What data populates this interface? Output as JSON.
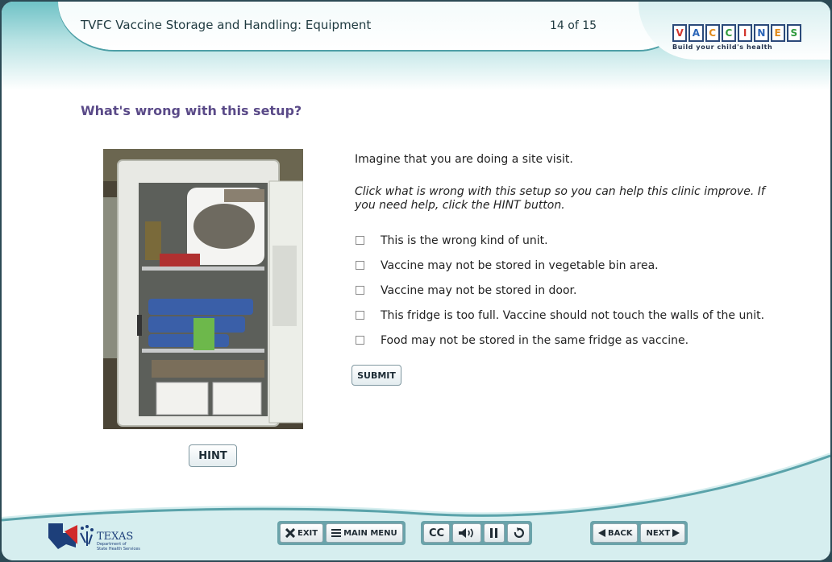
{
  "header": {
    "course_title": "TVFC Vaccine Storage and Handling: Equipment",
    "page_counter": "14 of 15",
    "logo_letters": [
      "V",
      "A",
      "C",
      "C",
      "I",
      "N",
      "E",
      "S"
    ],
    "logo_tagline": "Build your child's health"
  },
  "question": {
    "title": "What's wrong with this setup?",
    "intro": "Imagine that you are doing a site visit.",
    "instruction": "Click what is wrong with this setup so you can help this clinic improve. If you need help, click the HINT button.",
    "options": [
      "This is the wrong kind of unit.",
      "Vaccine may not be stored in vegetable bin area.",
      "Vaccine may not be stored in door.",
      "This fridge is too full. Vaccine should not touch the walls of the unit.",
      "Food may not be stored in the same fridge as vaccine."
    ],
    "submit_label": "SUBMIT",
    "hint_label": "HINT"
  },
  "footer": {
    "texas_label": "TEXAS",
    "texas_sub1": "Department of",
    "texas_sub2": "State Health Services",
    "exit_label": "EXIT",
    "main_menu_label": "MAIN MENU",
    "cc_label": "CC",
    "back_label": "BACK",
    "next_label": "NEXT"
  },
  "colors": {
    "accent_teal": "#6fc2c6",
    "title_purple": "#5a4a88"
  }
}
